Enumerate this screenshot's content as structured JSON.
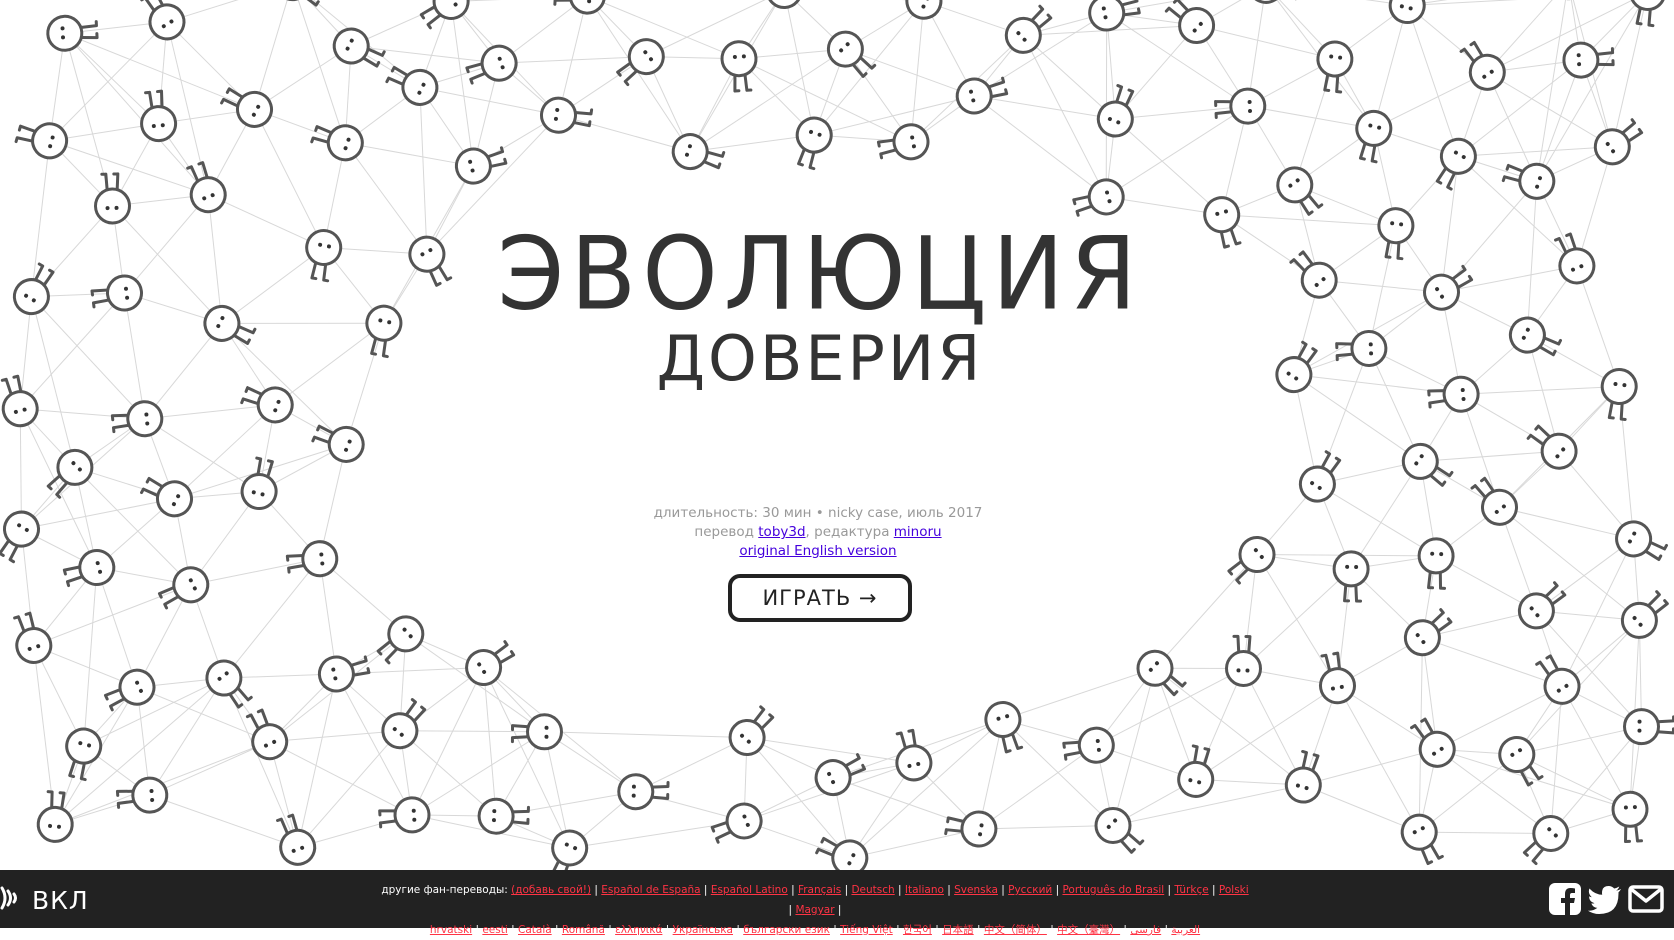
{
  "title": {
    "line1": "ЭВОЛЮЦИЯ",
    "line2": "ДОВЕРИЯ"
  },
  "meta": {
    "line1": "длительность: 30 мин • nicky case, июль 2017",
    "translation_prefix": "перевод",
    "translator": "toby3d",
    "editor_prefix": ", редактура",
    "editor": "minoru",
    "original_link": "original English version"
  },
  "play_button": {
    "label": "ИГРАТЬ →"
  },
  "footer": {
    "sound_label": "ВКЛ",
    "other_translations_label": "другие фан-переводы:",
    "add_yours": "(добавь свой!)",
    "languages_row1": [
      "Español de España",
      "Español Latino",
      "Français",
      "Deutsch",
      "Italiano",
      "Svenska",
      "Русский",
      "Português do Brasil",
      "Türkçe",
      "Polski",
      "Magyar"
    ],
    "languages_row2": [
      "hrvatski",
      "eesti",
      "Català",
      "Română",
      "ελληνικά",
      "Українська",
      "български език",
      "Tiếng Việt",
      "한국어",
      "日本語",
      "中文（简体）",
      "中文（臺灣）",
      "العربية",
      "فارسی"
    ],
    "colors": {
      "footer_bg": "#222222",
      "link": "#ff3344"
    }
  },
  "icons": {
    "sound": "speaker-sound-icon",
    "social": [
      "facebook-icon",
      "twitter-icon",
      "email-icon"
    ]
  }
}
